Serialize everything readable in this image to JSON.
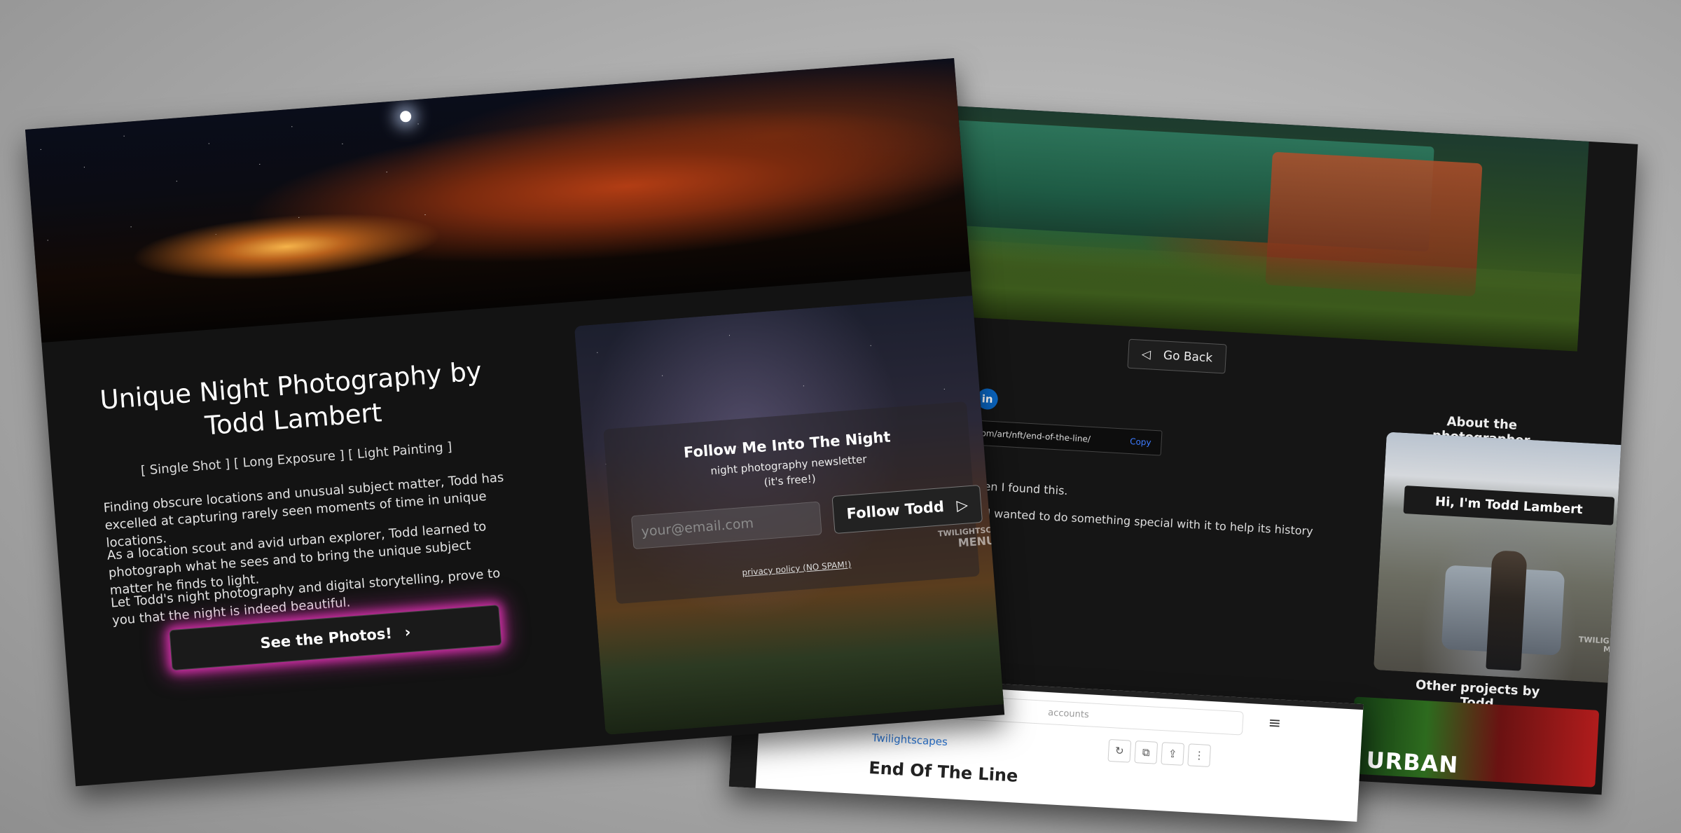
{
  "left": {
    "headline": "Unique Night Photography by Todd Lambert",
    "tags": "[ Single Shot ] [ Long Exposure ] [ Light Painting ]",
    "paragraphs": [
      "Finding obscure locations and unusual subject matter, Todd has excelled at capturing rarely seen moments of time in unique locations.",
      "As a location scout and avid urban explorer, Todd learned to photograph what he sees and to bring the unique subject matter he finds to light.",
      "Let Todd's night photography and digital storytelling, prove to you that the night is indeed beautiful."
    ],
    "cta": {
      "label": "See the Photos!",
      "icon": "›"
    },
    "newsletter": {
      "title": "Follow Me Into The Night",
      "subtitle": "night photography newsletter",
      "free_note": "(it's free!)",
      "email_placeholder": "your@email.com",
      "button_label": "Follow Todd",
      "button_icon": "send-icon",
      "privacy": "privacy policy (NO SPAM!)"
    },
    "watermark": {
      "line1": "TWILIGHTSCAPES",
      "line2": "MENU"
    }
  },
  "right": {
    "go_back": "Go Back",
    "share_icons": [
      "reddit-icon",
      "linkedin-icon"
    ],
    "url": "capes.com/art/nft/end-of-the-line/",
    "copy_label": "Copy",
    "body_lines": [
      "ght when I found this.",
      "ne, but I wanted to do something special with it to help its history"
    ],
    "about_title": "About the photographer",
    "about_badge": "Hi, I'm Todd Lambert",
    "other_title": "Other projects by Todd",
    "other_thumb_text": "URBAN",
    "watermark": {
      "line1": "TWILIGHTSCAPES",
      "line2": "MENU"
    },
    "embed": {
      "search_text": "accounts",
      "brand": "Twilightscapes",
      "title": "End Of The Line"
    }
  },
  "colors": {
    "cta_glow": "#d12fa8",
    "copy_link": "#3d7bff",
    "reddit": "#ff4500",
    "linkedin": "#0a66c2"
  }
}
